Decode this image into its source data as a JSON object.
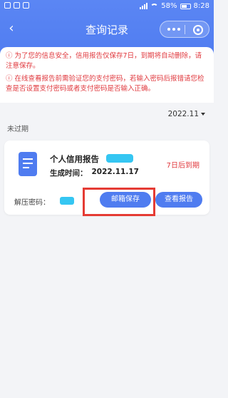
{
  "status_bar": {
    "battery": "58%",
    "time": "8:28"
  },
  "nav": {
    "back_icon": "chevron-left-icon",
    "title": "查询记录"
  },
  "notice": {
    "line1": "ⓘ 为了您的信息安全，信用报告仅保存7日，到期将自动删除，请注意保存。",
    "line2": "ⓘ 在线查看报告前需验证您的支付密码，若输入密码后报错请您检查是否设置支付密码或者支付密码是否输入正确。"
  },
  "filter": {
    "date": "2022.11"
  },
  "section": {
    "label": "未过期"
  },
  "report": {
    "title": "个人信用报告",
    "gen_label": "生成时间：",
    "gen_date": "2022.11.17",
    "expire": "7日后到期",
    "pwd_label": "解压密码：",
    "email_btn": "邮箱保存",
    "view_btn": "查看报告"
  },
  "colors": {
    "primary": "#4f7cf0",
    "warning": "#e0393e",
    "highlight": "#e53b34",
    "redaction": "#35c6f2"
  }
}
